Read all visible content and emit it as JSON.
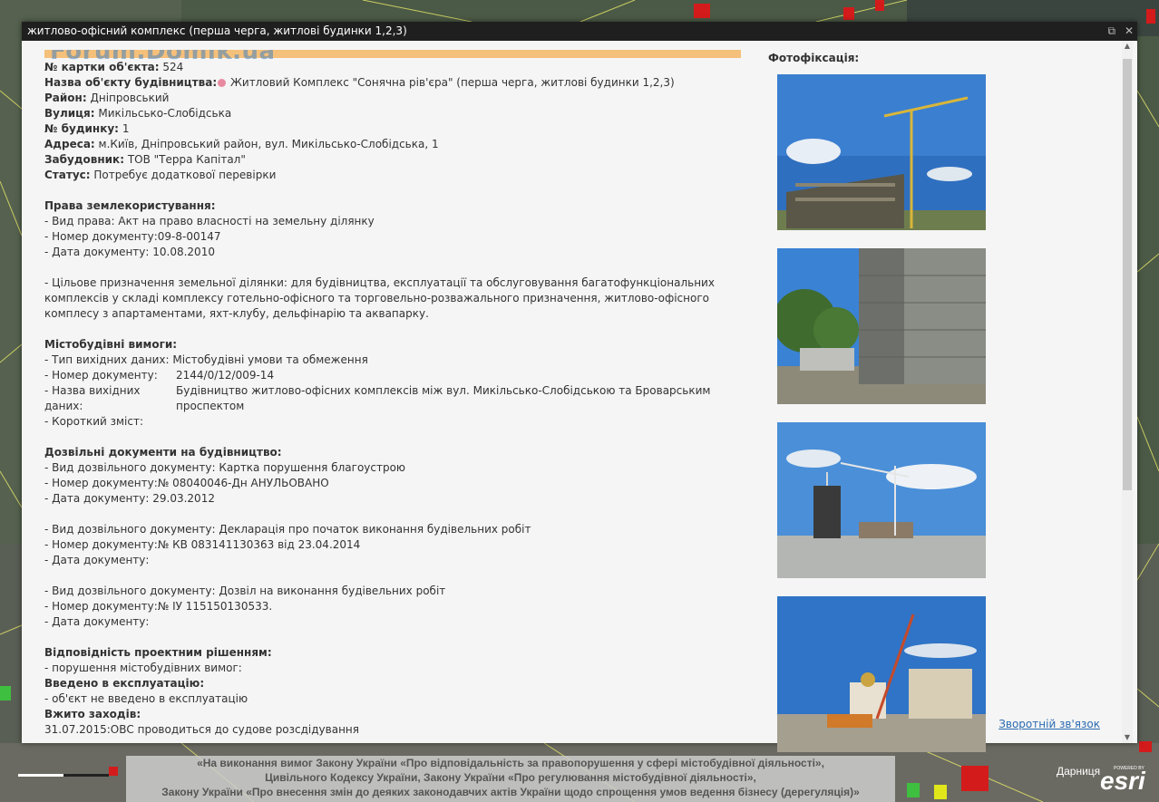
{
  "window": {
    "title": "житлово-офісний комплекс (перша черга, житлові будинки 1,2,3)",
    "restore_icon": "restore-icon",
    "close_icon": "close-icon"
  },
  "watermark": "Forum.Domik.ua",
  "info": {
    "card_label": "№ картки об'єкта:",
    "card_value": "524",
    "name_label": "Назва об'єкту будівництва:",
    "name_value": "Житловий Комплекс \"Сонячна рів'єра\" (перша черга, житлові будинки 1,2,3)",
    "district_label": "Район:",
    "district_value": "Дніпровський",
    "street_label": "Вулиця:",
    "street_value": "Микільсько-Слобідська",
    "house_label": "№ будинку:",
    "house_value": "1",
    "address_label": "Адреса:",
    "address_value": "м.Київ, Дніпровський район, вул. Микільсько-Слобідська, 1",
    "developer_label": "Забудовник:",
    "developer_value": "ТОВ \"Терра Капітал\"",
    "status_label": "Статус:",
    "status_value": "Потребує додаткової перевірки"
  },
  "land": {
    "heading": "Права землекористування:",
    "right_type": "- Вид права: Акт на право власності на земельну ділянку",
    "doc_number": "- Номер документу:09-8-00147",
    "doc_date": "- Дата документу:  10.08.2010",
    "purpose": "- Цільове призначення земельної ділянки: для будівництва, експлуатації та обслуговування багатофункціональних комплексів у складі комплексу готельно-офісного та торговельно-розважального призначення, житлово-офісного комплесу з апартаментами, яхт-клубу, дельфінарію та аквапарку."
  },
  "urban": {
    "heading": "Містобудівні вимоги:",
    "type": "- Тип вихідних даних: Містобудівні умови та обмеження",
    "num_label": "- Номер документу:",
    "num_value": "2144/0/12/009-14",
    "name_label": "- Назва вихідних даних:",
    "name_value": "Будівництво житлово-офісних комплексів між вул. Микільсько-Слобідською та Броварським проспектом",
    "summary": "- Короткий зміст:"
  },
  "permits": {
    "heading": "Дозвільні документи на будівництво:",
    "p1_type": "- Вид дозвільного документу: Картка порушення благоустрою",
    "p1_num": "- Номер документу:№ 08040046-Дн АНУЛЬОВАНО",
    "p1_date": "- Дата документу:  29.03.2012",
    "p2_type": "- Вид дозвільного документу: Декларація про початок виконання будівельних робіт",
    "p2_num": "- Номер документу:№ КВ 083141130363 від 23.04.2014",
    "p2_date": "- Дата документу:",
    "p3_type": "- Вид дозвільного документу: Дозвіл на виконання будівельних робіт",
    "p3_num": "- Номер документу:№ ІУ 115150130533.",
    "p3_date": "- Дата документу:"
  },
  "compliance": {
    "heading": "Відповідність проектним рішенням:",
    "value": "- порушення містобудівних вимог:",
    "commissioned_heading": "Введено в експлуатацію:",
    "commissioned_value": "- об'єкт не введено в експлуатацію",
    "measures_heading": "Вжито заходів:",
    "measures_value": "31.07.2015:ОВС проводиться до судове розсдідування"
  },
  "photos": {
    "title": "Фотофіксація:",
    "feedback_link": "Зворотній зв'язок"
  },
  "banner": {
    "line1": "«На виконання вимог Закону України «Про відповідальність за правопорушення у сфері містобудівної діяльності»,",
    "line2": "Цивільного Кодексу України, Закону України «Про регулювання містобудівної діяльності»,",
    "line3": "Закону України «Про внесення змін до деяких законодавчих актів України щодо спрощення умов ведення бізнесу (дерегуляція)»"
  },
  "map": {
    "attribution": "Дарниця",
    "esri_logo": "esri",
    "powered_by": "POWERED BY"
  }
}
